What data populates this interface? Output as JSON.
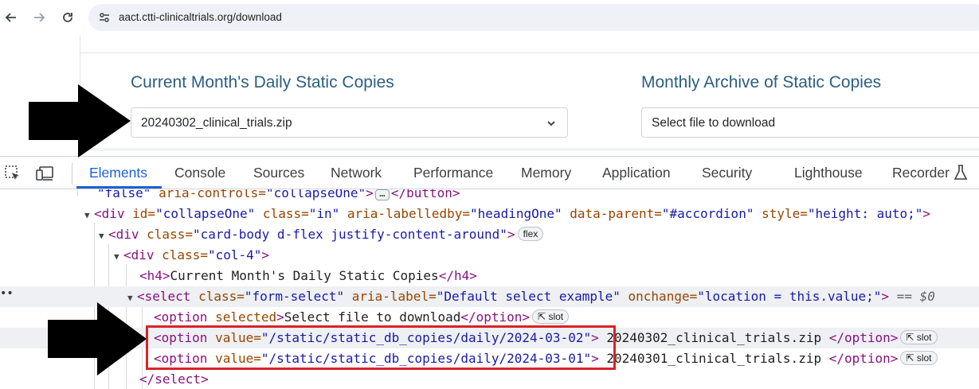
{
  "browser": {
    "url": "aact.ctti-clinicaltrials.org/download",
    "back_icon": "arrow-left-icon",
    "forward_icon": "arrow-right-icon",
    "reload_icon": "reload-icon",
    "site_info_icon": "tune-icon"
  },
  "page": {
    "daily": {
      "title": "Current Month's Daily Static Copies",
      "selected": "20240302_clinical_trials.zip"
    },
    "monthly": {
      "title": "Monthly Archive of Static Copies",
      "selected": "Select file to download"
    }
  },
  "devtools": {
    "tabs": [
      "Elements",
      "Console",
      "Sources",
      "Network",
      "Performance",
      "Memory",
      "Application",
      "Security",
      "Lighthouse",
      "Recorder"
    ],
    "active_tab": "Elements",
    "lines": {
      "l0": {
        "a": "\"false\"",
        "b": " aria-controls=",
        "c": "\"collapseOne\"",
        "d": ">",
        "e": "</button>"
      },
      "l1": {
        "open": "<div",
        "a1": " id=",
        "v1": "\"collapseOne\"",
        "a2": " class=",
        "v2": "\"in\"",
        "a3": " aria-labelledby=",
        "v3": "\"headingOne\"",
        "a4": " data-parent=",
        "v4": "\"#accordion\"",
        "a5": " style=",
        "v5": "\"height: auto;\"",
        "close": ">"
      },
      "l2": {
        "open": "<div",
        "a1": " class=",
        "v1": "\"card-body d-flex justify-content-around\"",
        "close": ">",
        "badge": "flex"
      },
      "l3": {
        "open": "<div",
        "a1": " class=",
        "v1": "\"col-4\"",
        "close": ">"
      },
      "l4": {
        "open": "<h4>",
        "text": "Current Month's Daily Static Copies",
        "close": "</h4>"
      },
      "l5": {
        "open": "<select",
        "a1": " class=",
        "v1": "\"form-select\"",
        "a2": " aria-label=",
        "v2": "\"Default select example\"",
        "a3": " onchange=",
        "v3": "\"location = this.value;\"",
        "close": ">",
        "eq": " == $0"
      },
      "l6": {
        "open": "<option",
        "a1": " selected",
        "close": ">",
        "text": "Select file to download",
        "end": "</option>",
        "badge": "slot"
      },
      "l7": {
        "open": "<option",
        "a1": " value=",
        "v1": "\"/static/static_db_copies/daily/2024-03-02\"",
        "close": ">",
        "text": " 20240302_clinical_trials.zip ",
        "end": "</option>",
        "badge": "slot"
      },
      "l8": {
        "open": "<option",
        "a1": " value=",
        "v1": "\"/static/static_db_copies/daily/2024-03-01\"",
        "close": ">",
        "text": " 20240301_clinical_trials.zip ",
        "end": "</option>",
        "badge": "slot"
      },
      "l9": {
        "close": "</select>"
      }
    },
    "dots": "••"
  },
  "colors": {
    "title": "#2b5f82",
    "active_tab": "#1a62d6",
    "highlight": "#d9232b"
  }
}
